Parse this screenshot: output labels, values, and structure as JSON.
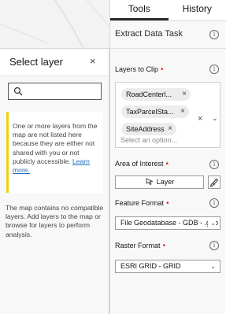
{
  "tabs": [
    {
      "label": "Tools",
      "active": true
    },
    {
      "label": "History",
      "active": false
    }
  ],
  "task": {
    "title": "Extract Data Task",
    "layers_to_clip": {
      "label": "Layers to Clip",
      "chips": [
        "RoadCenterl...",
        "TaxParcelSta...",
        "SiteAddress"
      ],
      "placeholder": "Select an option..."
    },
    "area_of_interest": {
      "label": "Area of Interest",
      "layer_button": "Layer"
    },
    "feature_format": {
      "label": "Feature Format",
      "value": "File Geodatabase - GDB - .gdb"
    },
    "raster_format": {
      "label": "Raster Format",
      "value": "ESRI GRID - GRID"
    }
  },
  "flyout": {
    "title": "Select layer",
    "search": {
      "placeholder": "",
      "value": ""
    },
    "notice": {
      "text": "One or more layers from the map are not listed here because they are either not shared with you or not publicly accessible. ",
      "link": "Learn more."
    },
    "empty_message": "The map contains no compatible layers. Add layers to the map or browse for layers to perform analysis."
  },
  "colors": {
    "required_dot": "#d83020",
    "notice_accent": "#edd317",
    "link": "#1f6fb8",
    "active_tab_underline": "#2a2a2a"
  },
  "icons": [
    "info-icon",
    "close-icon",
    "chevron-down-icon",
    "search-icon",
    "layer-select-icon",
    "draw-pen-icon"
  ]
}
